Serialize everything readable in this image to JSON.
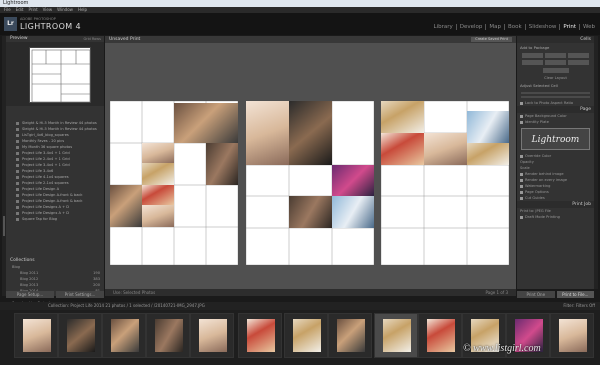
{
  "window": {
    "title": "Lightroom"
  },
  "menu": [
    "File",
    "Edit",
    "Print",
    "View",
    "Window",
    "Help"
  ],
  "identity": {
    "logo": "Lr",
    "subtitle": "ADOBE PHOTOSHOP",
    "brand": "LIGHTROOM 4"
  },
  "modules": [
    "Library",
    "Develop",
    "Map",
    "Book",
    "Slideshow",
    "Print",
    "Web"
  ],
  "active_module": "Print",
  "left": {
    "preview_title": "Preview",
    "preview_right": "Grid Rows",
    "templates": [
      "Sleight & Hi-5 Month in Review 44 photos",
      "Sleight & Hi-5 Month in Review 44 photos",
      "LisTgirl_4x6_blog_squares",
      "Monthly Faves - 20 pics",
      "My Month 36 square photos",
      "Project Life 3-4x4 + 1 Grid",
      "Project Life 2-4x4 + 1 Grid",
      "Project Life 3-4x4 + 1 Grid",
      "Project Life 3-4x6",
      "Project Life 4-1x4 squares",
      "Project Life 2-1x4 squares",
      "Project Life Design A",
      "Project Life Design A-front & back",
      "Project Life Design A-front & back",
      "Project Life Designs A + D",
      "Project Life Designs A + D",
      "Square Tap for Blog"
    ],
    "collections_title": "Collections",
    "collections": [
      {
        "label": "Blog",
        "count": ""
      },
      {
        "label": "Blog 2011",
        "count": "190"
      },
      {
        "label": "Blog 2012",
        "count": "383"
      },
      {
        "label": "Blog 2013",
        "count": "200"
      },
      {
        "label": "Blog 2014",
        "count": "81"
      },
      {
        "label": "Month In Review",
        "count": ""
      },
      {
        "label": "Scrapbooking Projects",
        "count": ""
      },
      {
        "label": "Balanced Little Mini",
        "count": "48"
      },
      {
        "label": "Mini YL photos",
        "count": "21"
      }
    ],
    "page_setup": "Page Setup...",
    "print_settings": "Print Settings..."
  },
  "center": {
    "doc_title": "Unsaved Print",
    "create_button": "Create Saved Print",
    "toolbar_left": "Use:   Selected Photos",
    "toolbar_right": "Page 1 of 3"
  },
  "right": {
    "cells_title": "Cells",
    "add_to_package": "Add to Package",
    "clear_layout": "Clear Layout",
    "adjust_cell": "Adjust Selected Cell",
    "lock_label": "Lock to Photo Aspect Ratio",
    "page_title": "Page",
    "page_bg": "Page Background Color",
    "identity_plate": "Identity Plate",
    "identity_text": "Lightroom",
    "override": "Override Color",
    "opacity": "Opacity",
    "scale": "Scale",
    "rotate": "Render behind image",
    "render": "Render on every image",
    "watermark": "Watermarking",
    "page_options": "Page Options",
    "cut_guides": "Cut Guides",
    "print_job": "Print Job",
    "print_to": "Print to:",
    "print_to_value": "JPEG File",
    "draft": "Draft Mode Printing",
    "print_button": "Print One",
    "print_file_button": "Print to File..."
  },
  "filmstrip": {
    "collection": "Collection: Project Life 2014",
    "count": "21 photos / 1 selected /",
    "file": "/20140721-IMG_2947.JPG",
    "filter_label": "Filter:",
    "filter_value": "Filters Off",
    "watermark": "© www.listgirl.com"
  }
}
